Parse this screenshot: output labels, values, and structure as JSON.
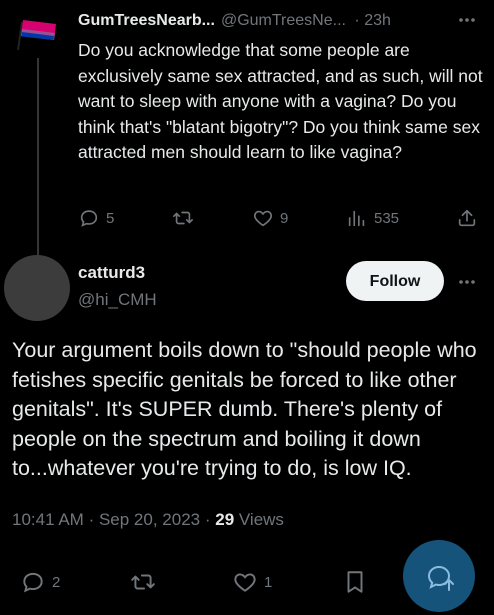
{
  "parent_tweet": {
    "display_name": "GumTreesNearb...",
    "handle": "@GumTreesNe...",
    "time": "· 23h",
    "text": "Do you acknowledge that some people are exclusively same sex attracted, and as such, will not want to sleep with anyone with a vagina? Do you think that's \"blatant bigotry\"? Do you think same sex attracted men should learn to like vagina?",
    "replies": "5",
    "likes": "9",
    "views": "535"
  },
  "main_tweet": {
    "display_name": "catturd3",
    "handle": "@hi_CMH",
    "follow_label": "Follow",
    "text": "Your argument boils down to \"should people who fetishes specific genitals be forced to like other genitals\". It's SUPER dumb. There's plenty of people on the spectrum and boiling it down to...whatever you're trying to do, is low IQ.",
    "time": "10:41 AM",
    "date": "Sep 20, 2023",
    "views_count": "29",
    "views_label": "Views",
    "replies": "2",
    "likes": "1"
  },
  "colors": {
    "accent": "#1d9bf0",
    "muted": "#71767b",
    "text": "#e7e9ea"
  },
  "icons": [
    "flag-avatar",
    "more-icon",
    "reply-icon",
    "retweet-icon",
    "like-icon",
    "views-icon",
    "share-icon",
    "bookmark-icon",
    "compose-icon"
  ]
}
